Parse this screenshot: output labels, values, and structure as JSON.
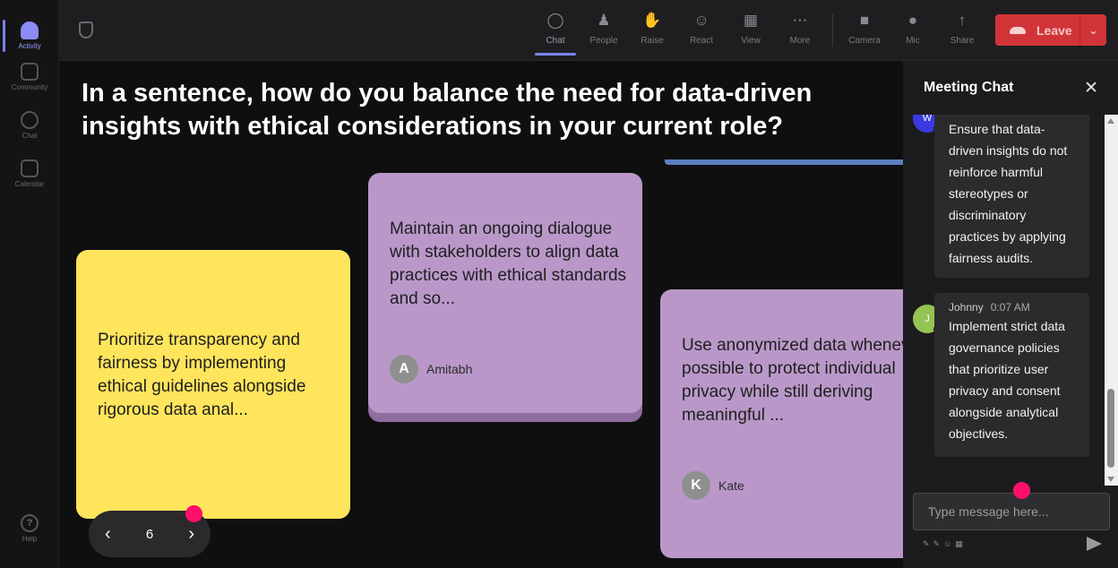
{
  "rail": {
    "items": [
      {
        "label": "Activity",
        "active": true
      },
      {
        "label": "Community",
        "active": false
      },
      {
        "label": "Chat",
        "active": false
      },
      {
        "label": "Calendar",
        "active": false
      }
    ],
    "help": "Help"
  },
  "toolbar": {
    "buttons": [
      {
        "label": "Chat",
        "icon": "chat-icon"
      },
      {
        "label": "People",
        "icon": "people-icon"
      },
      {
        "label": "Raise",
        "icon": "raise-hand-icon"
      },
      {
        "label": "React",
        "icon": "react-icon"
      },
      {
        "label": "View",
        "icon": "view-icon"
      },
      {
        "label": "More",
        "icon": "more-icon"
      },
      {
        "label": "Camera",
        "icon": "camera-icon"
      },
      {
        "label": "Mic",
        "icon": "mic-icon"
      },
      {
        "label": "Share",
        "icon": "share-icon"
      }
    ],
    "leave_label": "Leave"
  },
  "stage": {
    "question": "In a sentence, how do you balance the need for data-driven insights with ethical considerations in your current role?",
    "cards": [
      {
        "text": "Prioritize transparency and fairness by implementing ethical guidelines alongside rigorous data anal...",
        "author": "",
        "initial": ""
      },
      {
        "text": "Maintain an ongoing dialogue with stakeholders to align data practices with ethical standards and so...",
        "author": "Amitabh",
        "initial": "A"
      },
      {
        "text": "Use anonymized data whenever possible to protect individual privacy while still deriving meaningful ...",
        "author": "Kate",
        "initial": "K"
      }
    ],
    "page": "6"
  },
  "chat": {
    "title": "Meeting Chat",
    "messages": [
      {
        "sender": "",
        "initial": "W",
        "time": "",
        "text": "Ensure that data-driven insights do not reinforce harmful stereotypes or discriminatory practices by applying fairness audits."
      },
      {
        "sender": "Johnny",
        "initial": "J",
        "time": "0:07 AM",
        "text": "Implement strict data governance policies that prioritize user privacy and consent alongside analytical objectives."
      }
    ],
    "input_placeholder": "Type message here..."
  },
  "colors": {
    "accent": "#7b83eb",
    "leave": "#d13438",
    "yellow_card": "#ffe55c",
    "purple_card": "#b998c9",
    "marker": "#ff0f6a"
  }
}
